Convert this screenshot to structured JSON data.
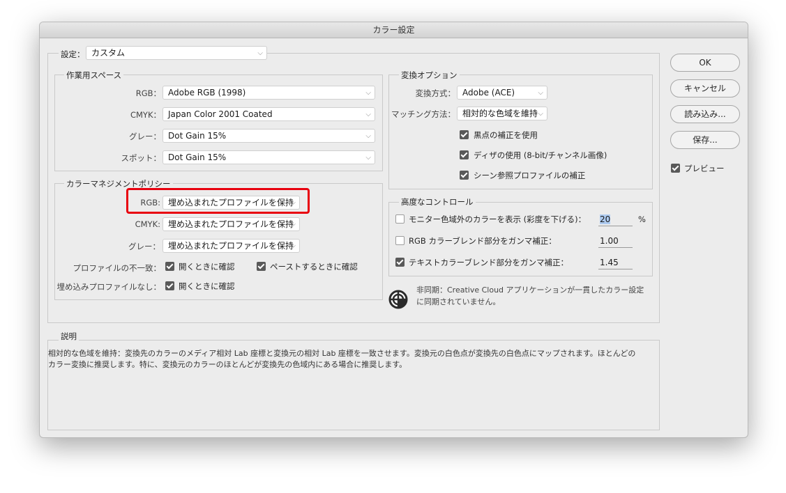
{
  "window": {
    "title": "カラー設定"
  },
  "settings": {
    "label": "設定：",
    "value": "カスタム"
  },
  "working_spaces": {
    "title": "作業用スペース",
    "rows": [
      {
        "label": "RGB：",
        "value": "Adobe RGB (1998)"
      },
      {
        "label": "CMYK：",
        "value": "Japan Color 2001 Coated"
      },
      {
        "label": "グレー：",
        "value": "Dot Gain 15%"
      },
      {
        "label": "スポット：",
        "value": "Dot Gain 15%"
      }
    ]
  },
  "conversion": {
    "title": "変換オプション",
    "engine_label": "変換方式：",
    "engine_value": "Adobe (ACE)",
    "intent_label": "マッチング方法：",
    "intent_value": "相対的な色域を維持",
    "checks": [
      {
        "label": "黒点の補正を使用",
        "checked": true
      },
      {
        "label": "ディザの使用 (8-bit/チャンネル画像)",
        "checked": true
      },
      {
        "label": "シーン参照プロファイルの補正",
        "checked": true
      }
    ]
  },
  "policies": {
    "title": "カラーマネジメントポリシー",
    "rows": [
      {
        "label": "RGB:",
        "value": "埋め込まれたプロファイルを保持"
      },
      {
        "label": "CMYK:",
        "value": "埋め込まれたプロファイルを保持"
      },
      {
        "label": "グレー：",
        "value": "埋め込まれたプロファイルを保持"
      }
    ],
    "mismatch_label": "プロファイルの不一致：",
    "mismatch_open": "開くときに確認",
    "mismatch_paste": "ペーストするときに確認",
    "missing_label": "埋め込みプロファイルなし：",
    "missing_open": "開くときに確認"
  },
  "advanced": {
    "title": "高度なコントロール",
    "desaturate_label": "モニター色域外のカラーを表示 (彩度を下げる)：",
    "desaturate_value": "20",
    "desaturate_unit": "%",
    "rgb_blend_label": "RGB カラーブレンド部分をガンマ補正：",
    "rgb_blend_value": "1.00",
    "text_blend_label": "テキストカラーブレンド部分をガンマ補正：",
    "text_blend_value": "1.45"
  },
  "sync": {
    "line1": "非同期：Creative Cloud アプリケーションが一貫したカラー設定",
    "line2": "に同期されていません。"
  },
  "description": {
    "title": "説明",
    "line1": "相対的な色域を維持：変換先のカラーのメディア相対 Lab 座標と変換元の相対 Lab 座標を一致させます。変換元の白色点が変換先の白色点にマップされます。ほとんどの",
    "line2": "カラー変換に推奨します。特に、変換元のカラーのほとんどが変換先の色域内にある場合に推奨します。"
  },
  "buttons": {
    "ok": "OK",
    "cancel": "キャンセル",
    "load": "読み込み...",
    "save": "保存..."
  },
  "preview": {
    "label": "プレビュー",
    "checked": true
  },
  "colors": {
    "highlight": "#e8000f",
    "checkbox": "#595959"
  }
}
